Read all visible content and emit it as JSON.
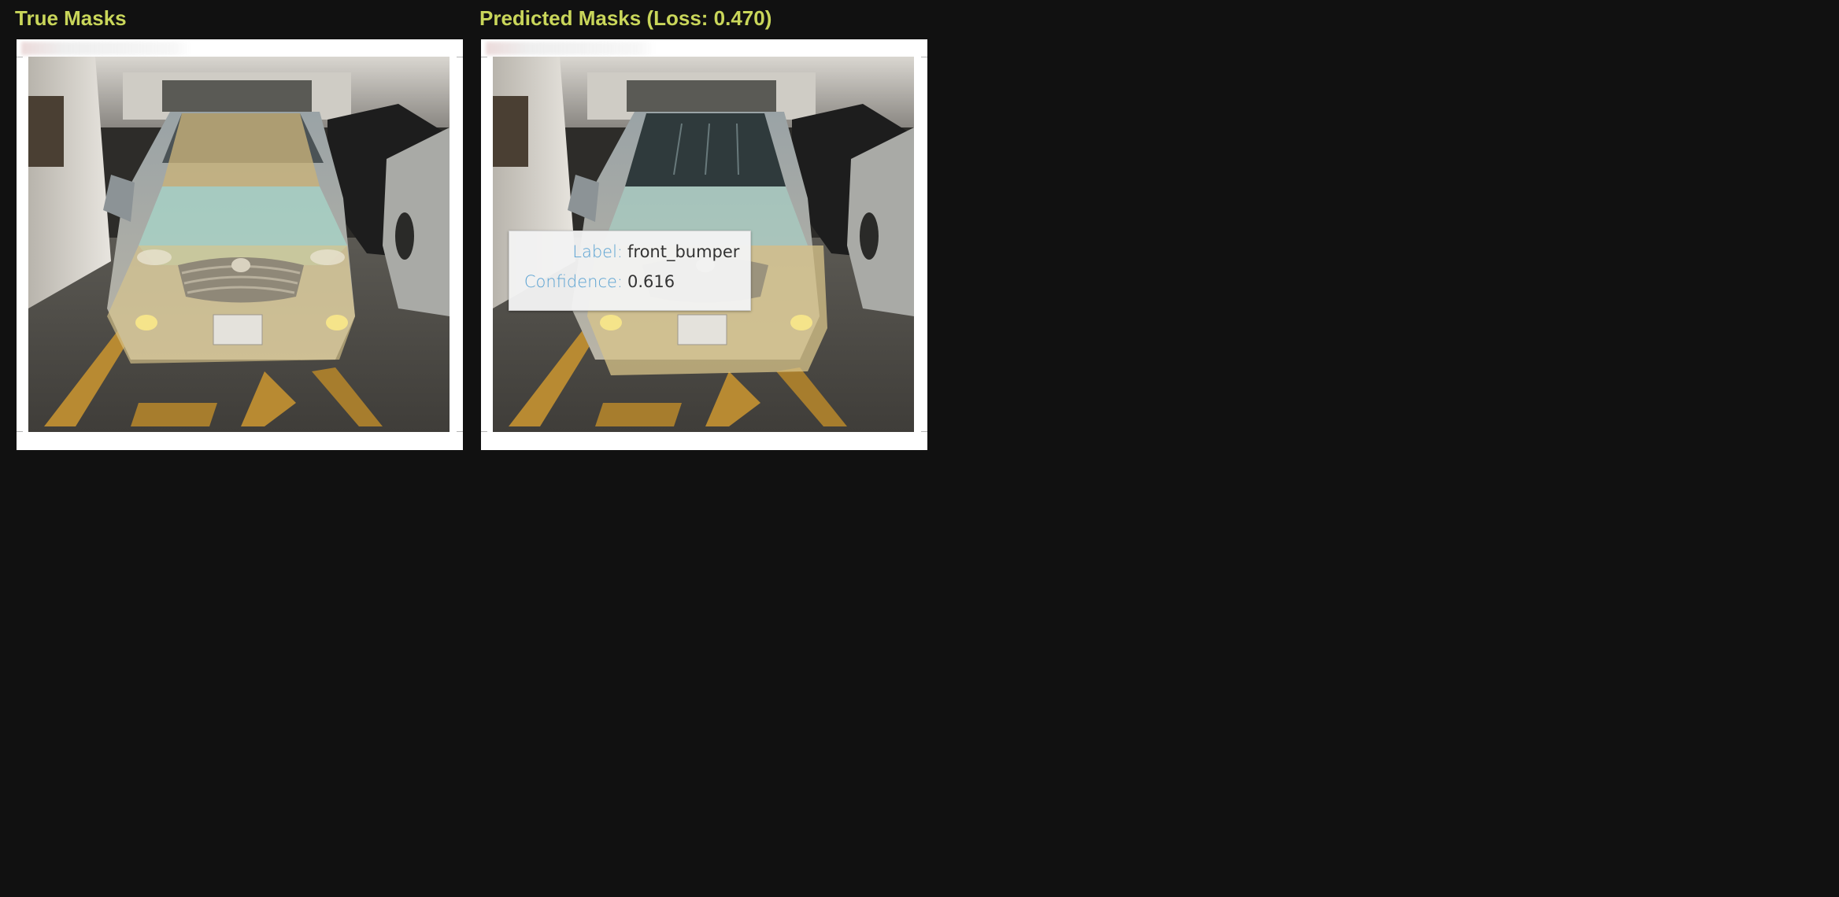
{
  "panels": [
    {
      "title": "True Masks"
    },
    {
      "title": "Predicted Masks (Loss: 0.470)"
    }
  ],
  "tooltip": {
    "label_key": "Label:",
    "label_value": "front_bumper",
    "confidence_key": "Confidence:",
    "confidence_value": "0.616"
  },
  "colors": {
    "background": "#111111",
    "title": "#c9d65a",
    "tooltip_key": "#5aa2d2",
    "tooltip_value": "#333333",
    "mask_teal": "#a7d8cc",
    "mask_gold": "#d8c48a"
  },
  "images": [
    {
      "subject": "silver-sedan-front-view",
      "masks": [
        "windshield",
        "hood",
        "front_bumper"
      ]
    },
    {
      "subject": "silver-sedan-front-view",
      "masks": [
        "hood",
        "front_bumper"
      ]
    }
  ]
}
